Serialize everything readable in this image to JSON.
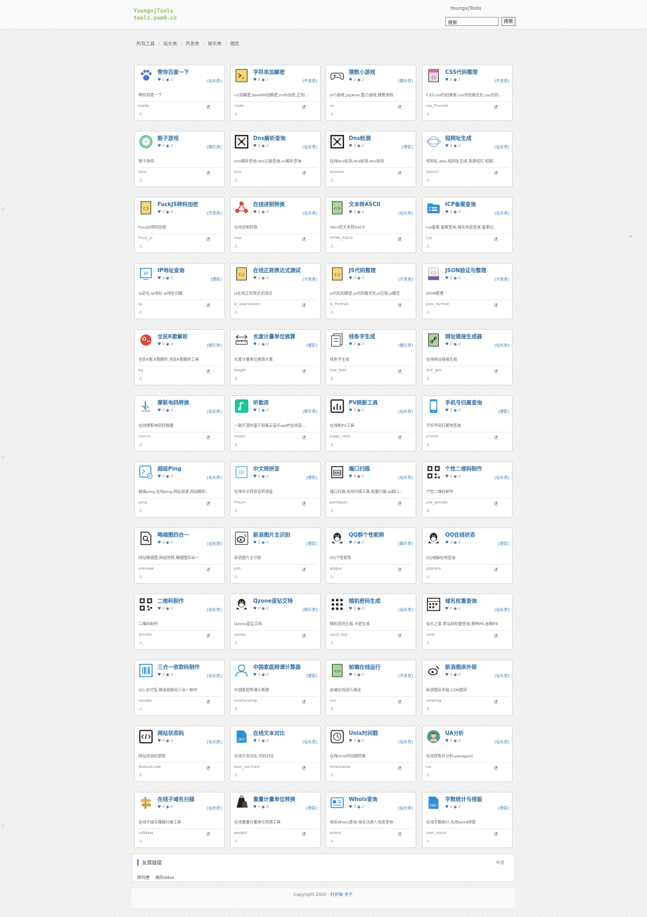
{
  "header": {
    "logo_line1": "YoungxjTools",
    "logo_line2": "tools.yum6.cn",
    "site_name": "YoungxjTools",
    "search_placeholder": "搜索",
    "search_button": "搜索"
  },
  "breadcrumb": [
    "所有工具",
    "站长类",
    "开发类",
    "娱乐类",
    "便民"
  ],
  "tools": [
    {
      "title": "帮你百度一下",
      "likes": "0",
      "views": "3",
      "category": "[站长类]",
      "desc": "帮你百度一下",
      "slug": "baidu",
      "icon": "paw-icon"
    },
    {
      "title": "字符串加解密",
      "likes": "0",
      "views": "1",
      "category": "[开发类]",
      "desc": "url加解密,base64加解密,md5加密,正则...",
      "slug": "code",
      "icon": "terminal-icon"
    },
    {
      "title": "猜数小游戏",
      "likes": "0",
      "views": "2",
      "category": "[娱乐类]",
      "desc": "js小游戏,jsgame,智力游戏,猜数游戏",
      "slug": "cs",
      "icon": "gamepad-icon"
    },
    {
      "title": "CSS代码整理",
      "likes": "0",
      "views": "1",
      "category": "[开发类]",
      "desc": "CSS,css代码美观,css代码格式化,css代码...",
      "slug": "css_Format",
      "icon": "css-file-icon"
    },
    {
      "title": "骰子游戏",
      "likes": "0",
      "views": "0",
      "category": "[娱乐类]",
      "desc": "骰子游戏",
      "slug": "dice",
      "icon": "dice-icon"
    },
    {
      "title": "Dns解析查询",
      "likes": "0",
      "views": "0",
      "category": "[站长类]",
      "desc": "dns解析查询,dns记录查询,ns解析查询",
      "slug": "dns",
      "icon": "dns-icon"
    },
    {
      "title": "Dns检测",
      "likes": "0",
      "views": "0",
      "category": "[便民]",
      "desc": "在线dns检测,dns检测,dns劫持",
      "slug": "dnstest",
      "icon": "dns-test-icon"
    },
    {
      "title": "短网址生成",
      "likes": "0",
      "views": "0",
      "category": "[站长类]",
      "desc": "短网址,dwz,短网址生成,免费短红,短链...",
      "slug": "dwzurl",
      "icon": "globe-icon"
    },
    {
      "title": "FuckJS转码加密",
      "likes": "0",
      "views": "0",
      "category": "[开发类]",
      "desc": "FuckJS转码加密",
      "slug": "Fuck_js",
      "icon": "code-file-icon"
    },
    {
      "title": "在线进制转换",
      "likes": "0",
      "views": "0",
      "category": "[站长类]",
      "desc": "在线进制转换",
      "slug": "hex",
      "icon": "hex-icon"
    },
    {
      "title": "文本转ASCII",
      "likes": "0",
      "views": "1",
      "category": "[站长类]",
      "desc": "Html转文本转ASCII",
      "slug": "HTML_ASCII",
      "icon": "html-file-icon"
    },
    {
      "title": "ICP备案查询",
      "likes": "0",
      "views": "0",
      "category": "[站长类]",
      "desc": "icp备案,备案查询,域名信息查询,备案记...",
      "slug": "icp",
      "icon": "folder-icon"
    },
    {
      "title": "IP地址查询",
      "likes": "0",
      "views": "0",
      "category": "[便民]",
      "desc": "ip定位,ip地址,ip地址归属",
      "slug": "ip",
      "icon": "ip-icon"
    },
    {
      "title": "在线正则表达式测试",
      "likes": "0",
      "views": "0",
      "category": "[开发类]",
      "desc": "js在线正则表达式测试",
      "slug": "js_expression",
      "icon": "regex-file-icon"
    },
    {
      "title": "JS代码整理",
      "likes": "0",
      "views": "0",
      "category": "[开发类]",
      "desc": "Js代码加解密,js代码格式化,js压缩,js解压",
      "slug": "js_Format",
      "icon": "js-file-icon"
    },
    {
      "title": "JSON验证与整理",
      "likes": "0",
      "views": "0",
      "category": "[开发类]",
      "desc": "JSON整理",
      "slug": "json_format",
      "icon": "json-icon"
    },
    {
      "title": "全民K歌解析",
      "likes": "0",
      "views": "0",
      "category": "[娱乐类]",
      "desc": "全民K歌,K歌解析,全民K歌解析工具",
      "slug": "kg",
      "icon": "bird-icon"
    },
    {
      "title": "长度计量单位换算",
      "likes": "0",
      "views": "0",
      "category": "[便民]",
      "desc": "长度计量单位换算计算",
      "slug": "length",
      "icon": "ruler-icon"
    },
    {
      "title": "线条字生成",
      "likes": "0",
      "views": "0",
      "category": "[娱乐类]",
      "desc": "线条字生成",
      "slug": "line_text",
      "icon": "document-icon"
    },
    {
      "title": "网址链接生成器",
      "likes": "0",
      "views": "0",
      "category": "[站长类]",
      "desc": "在线网址链接生成",
      "slug": "link_get",
      "icon": "link-file-icon"
    },
    {
      "title": "摩斯电码转换",
      "likes": "0",
      "views": "0",
      "category": "[站长类]",
      "desc": "在线摩斯电码转换器",
      "slug": "morse",
      "icon": "morse-icon"
    },
    {
      "title": "听歌房",
      "likes": "0",
      "views": "0",
      "category": "[娱乐类]",
      "desc": "一款开源的基于网易云音乐api的在线音...",
      "slug": "music",
      "icon": "music-icon"
    },
    {
      "title": "PV刷新工具",
      "likes": "0",
      "views": "0",
      "category": "[站长类]",
      "desc": "在线刷PV工具",
      "slug": "page_view",
      "icon": "bar-chart-icon"
    },
    {
      "title": "手机号归属查询",
      "likes": "0",
      "views": "0",
      "category": "[便民]",
      "desc": "手机号码归属地查询",
      "slug": "phone",
      "icon": "phone-icon"
    },
    {
      "title": "超级Ping",
      "likes": "0",
      "views": "0",
      "category": "[站长类]",
      "desc": "超级ping,在线ping,网站测速,网站解析...",
      "slug": "ping",
      "icon": "ping-icon"
    },
    {
      "title": "中文转拼音",
      "likes": "0",
      "views": "0",
      "category": "[便民]",
      "desc": "在线中文转拼音转语音",
      "slug": "Pinyin",
      "icon": "pinyin-icon"
    },
    {
      "title": "端口扫描",
      "likes": "0",
      "views": "0",
      "category": "[站长类]",
      "desc": "端口扫描,在线扫描工具,批量扫描,ip端口...",
      "slug": "portblast",
      "icon": "router-icon"
    },
    {
      "title": "个性二维码制作",
      "likes": "0",
      "views": "0",
      "category": "[站长类]",
      "desc": "个性二维码制作",
      "slug": "pre_qrcode",
      "icon": "qrcode-icon"
    },
    {
      "title": "略缩图四合一",
      "likes": "0",
      "views": "0",
      "category": "[站长类]",
      "desc": "网站略缩图,网站快照,略缩图四合一",
      "slug": "preview",
      "icon": "search-file-icon"
    },
    {
      "title": "新浪图片主识别",
      "likes": "0",
      "views": "0",
      "category": "[便民]",
      "desc": "新浪图片主识别",
      "slug": "pro",
      "icon": "weibo-icon"
    },
    {
      "title": "QQ群个性昵称",
      "likes": "0",
      "views": "0",
      "category": "[娱乐类]",
      "desc": "QQ个性昵称",
      "slug": "qqqun",
      "icon": "qq-icon"
    },
    {
      "title": "QQ在线状态",
      "likes": "0",
      "views": "0",
      "category": "[便民]",
      "desc": "QQ电脑在线查询",
      "slug": "qqstate",
      "icon": "qq-state-icon"
    },
    {
      "title": "二维码制作",
      "likes": "0",
      "views": "0",
      "category": "[站长类]",
      "desc": "二维码制作",
      "slug": "qrcode",
      "icon": "qrcode2-icon"
    },
    {
      "title": "Qzone蓝钻艾特",
      "likes": "0",
      "views": "0",
      "category": "[娱乐类]",
      "desc": "Qzone蓝钻艾特",
      "slug": "qzone",
      "icon": "qzone-icon"
    },
    {
      "title": "随机密码生成",
      "likes": "0",
      "views": "0",
      "category": "[站长类]",
      "desc": "随机密码生成,卡密生成",
      "slug": "rand_key",
      "icon": "dots-grid-icon"
    },
    {
      "title": "域名权重查询",
      "likes": "0",
      "views": "0",
      "category": "[站长类]",
      "desc": "站长之家,爱站网权重查询,搜狗PR,谷歌PR",
      "slug": "rank",
      "icon": "rank-icon"
    },
    {
      "title": "三合一收款码制作",
      "likes": "0",
      "views": "0",
      "category": "[站长类]",
      "desc": "QQ,支付宝,微信收款码三合一制作",
      "slug": "recode",
      "icon": "barcode-icon"
    },
    {
      "title": "中国家庭称谓计算器",
      "likes": "0",
      "views": "0",
      "category": "[便民]",
      "desc": "中国家庭称谓计算器",
      "slug": "relationship",
      "icon": "person-icon"
    },
    {
      "title": "前端在线运行",
      "likes": "0",
      "views": "0",
      "category": "[开发类]",
      "desc": "前端在线运行调试",
      "slug": "run",
      "icon": "html-run-icon"
    },
    {
      "title": "新浪图床外链",
      "likes": "0",
      "views": "0",
      "category": "[站长类]",
      "desc": "新浪图床外链,CDN图床",
      "slug": "sinaimg",
      "icon": "weibo2-icon"
    },
    {
      "title": "网站状态码",
      "likes": "0",
      "views": "0",
      "category": "[站长类]",
      "desc": "网站状态码获取",
      "slug": "StatusCode",
      "icon": "code-icon"
    },
    {
      "title": "在线文本对比",
      "likes": "0",
      "views": "0",
      "category": "[站长类]",
      "desc": "在线文本对比,代码对比",
      "slug": "text_contrast",
      "icon": "doc-icon"
    },
    {
      "title": "Unix时间戳",
      "likes": "0",
      "views": "0",
      "category": "[站长类]",
      "desc": "在线Unix时间戳转换",
      "slug": "timestamp",
      "icon": "clock-icon"
    },
    {
      "title": "UA分析",
      "likes": "0",
      "views": "0",
      "category": "[站长类]",
      "desc": "在线获取并分析useragent",
      "slug": "ua",
      "icon": "avatar-icon"
    },
    {
      "title": "在线子域名扫描",
      "likes": "0",
      "views": "0",
      "category": "[站长类]",
      "desc": "在线子域名爆破扫描工具",
      "slug": "urlblast",
      "icon": "signpost-icon"
    },
    {
      "title": "重量计量单位转换",
      "likes": "0",
      "views": "0",
      "category": "[便民]",
      "desc": "在线重量计量单位转换工具",
      "slug": "weight",
      "icon": "weight-icon"
    },
    {
      "title": "Whois查询",
      "likes": "0",
      "views": "0",
      "category": "[站长类]",
      "desc": "域名Whois查询,域名注册人信息查询",
      "slug": "whois",
      "icon": "id-card-icon"
    },
    {
      "title": "字数统计与排版",
      "likes": "0",
      "views": "0",
      "category": "[便民]",
      "desc": "在线字数统计,在线word排版",
      "slug": "text_count",
      "icon": "doc2-icon"
    }
  ],
  "card_labels": {
    "enter1": "进",
    "enter2": "入"
  },
  "friend_links": {
    "title": "友情链接",
    "apply": "申请",
    "items": [
      "婷玛屋",
      "高防ddos"
    ]
  },
  "footer": {
    "copyright": "Copyright 2020 · ",
    "link1": "时间轴",
    "link2": "关于"
  },
  "colors": {
    "accent": "#2e6da4",
    "logo": "#8cc152",
    "link_bar": "#3a8ee6"
  }
}
